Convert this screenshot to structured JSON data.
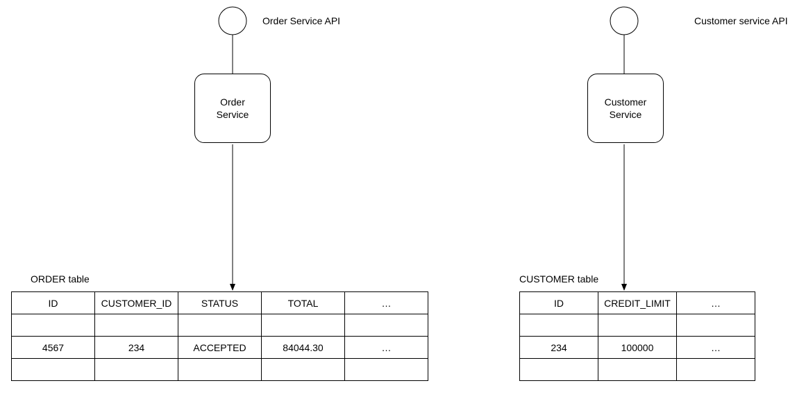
{
  "order": {
    "api_label": "Order Service API",
    "service_label": "Order\nService",
    "table_title": "ORDER table",
    "headers": [
      "ID",
      "CUSTOMER_ID",
      "STATUS",
      "TOTAL",
      "…"
    ],
    "row": [
      "4567",
      "234",
      "ACCEPTED",
      "84044.30",
      "…"
    ]
  },
  "customer": {
    "api_label": "Customer service API",
    "service_label": "Customer\nService",
    "table_title": "CUSTOMER table",
    "headers": [
      "ID",
      "CREDIT_LIMIT",
      "…"
    ],
    "row": [
      "234",
      "100000",
      "…"
    ]
  }
}
